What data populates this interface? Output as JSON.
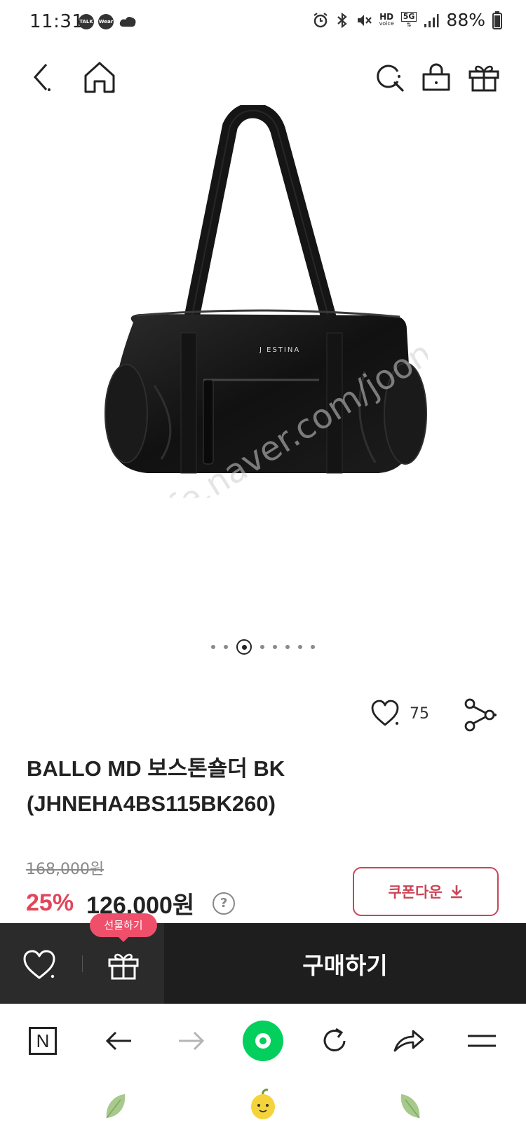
{
  "status_bar": {
    "time": "11:31",
    "badges": [
      "TALK",
      "Wear"
    ],
    "network": "5G",
    "hd_label": "HD",
    "hd_sub": "voice",
    "battery": "88%"
  },
  "header": {
    "icons": [
      "back-icon",
      "home-icon",
      "search-icon",
      "shopping-bag-icon",
      "gift-icon"
    ]
  },
  "image": {
    "brand_text": "J ESTINA",
    "watermark": "cafe.naver.com/joonggonara"
  },
  "pagination": {
    "total": 9,
    "active_index": 2
  },
  "actions": {
    "like_count": "75"
  },
  "product": {
    "title_line1": "BALLO MD 보스톤숄더 BK",
    "title_line2": "(JHNEHA4BS115BK260)",
    "original_price": "168,000원",
    "discount": "25%",
    "sale_price": "126,000원",
    "help_glyph": "?"
  },
  "coupon": {
    "label": "쿠폰다운"
  },
  "purchase": {
    "gift_tooltip": "선물하기",
    "buy_label": "구매하기"
  },
  "browser_nav": {
    "n_label": "N"
  },
  "colors": {
    "accent_red": "#e2455a",
    "coupon_red": "#c94557",
    "tooltip_pink": "#ef4f6a",
    "naver_green": "#03cf5d",
    "purchase_bar": "#1e1e1e"
  }
}
